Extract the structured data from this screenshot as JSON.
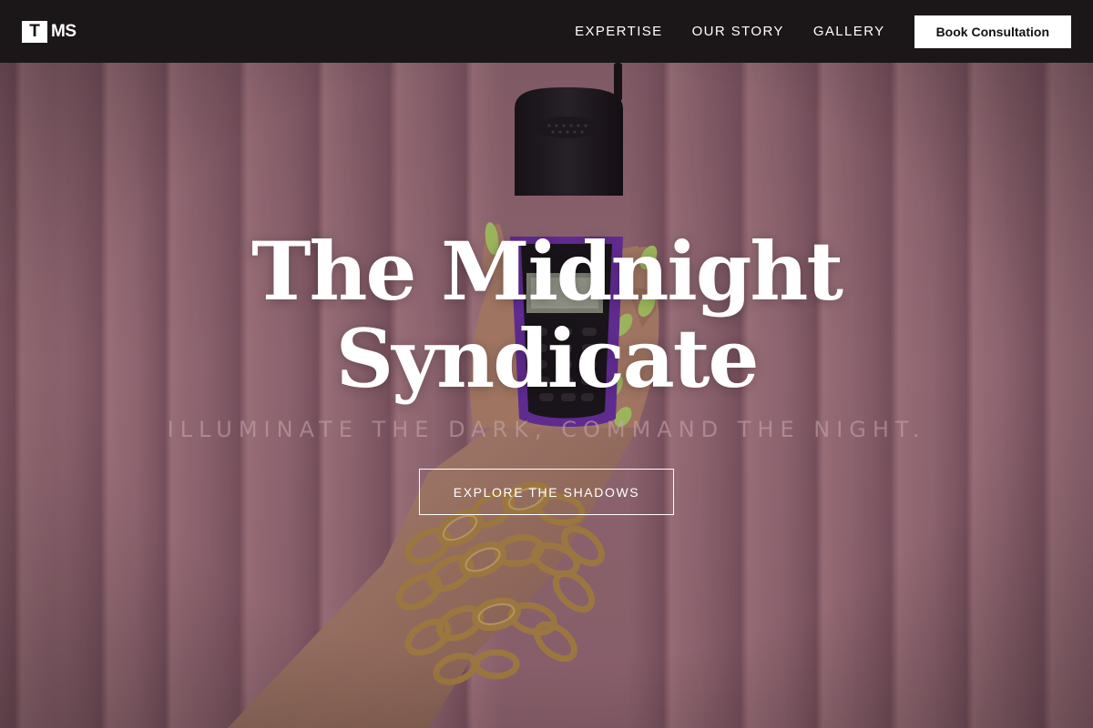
{
  "brand": {
    "logo_mark": "T",
    "logo_text": "MS"
  },
  "nav": {
    "links": [
      "EXPERTISE",
      "OUR STORY",
      "GALLERY"
    ],
    "cta_label": "Book Consultation"
  },
  "hero": {
    "title_line1": "The Midnight",
    "title_line2": "Syndicate",
    "tagline": "ILLUMINATE THE DARK, COMMAND THE NIGHT.",
    "button_label": "EXPLORE THE SHADOWS",
    "image_alt": "hand-holding-flip-phone-photo"
  },
  "colors": {
    "nav_bg": "#1b1718",
    "curtain": "#9f6f7b",
    "accent_nail": "#b4d66a",
    "gold": "#b58a47",
    "beads": "#6b2fa8"
  }
}
